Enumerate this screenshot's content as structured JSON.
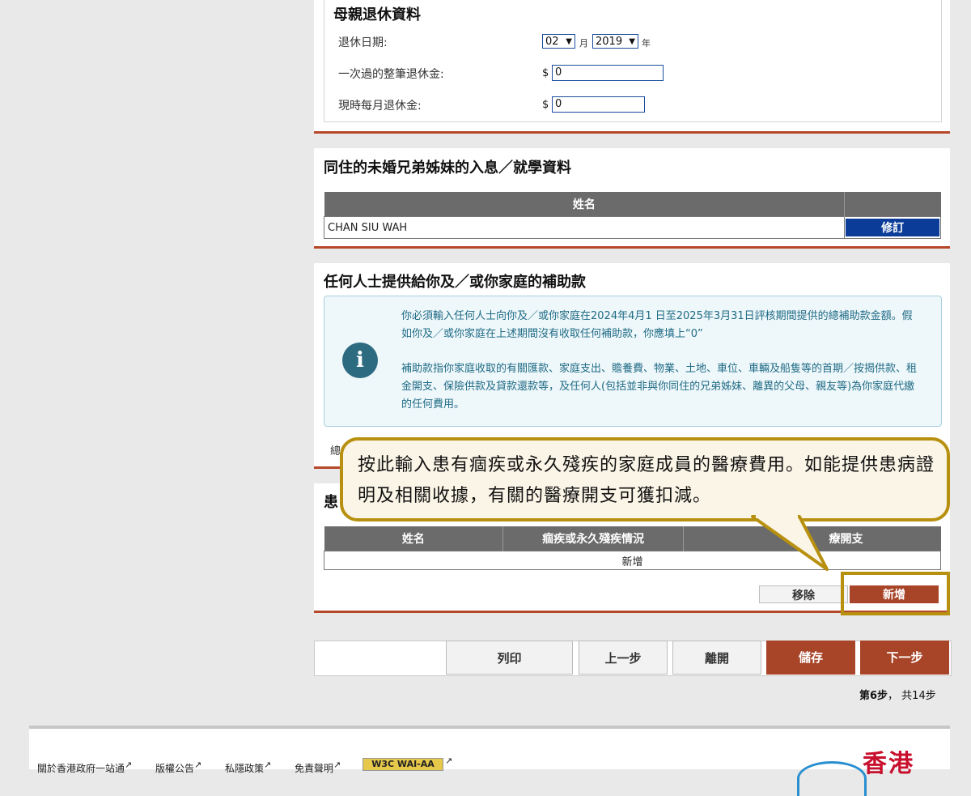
{
  "retirement": {
    "title": "母親退休資料",
    "retire_date_label": "退休日期:",
    "month_value": "02",
    "month_unit": "月",
    "year_value": "2019",
    "year_unit": "年",
    "lump_sum_label": "一次過的整筆退休金:",
    "lump_sum_value": "0",
    "monthly_label": "現時每月退休金:",
    "monthly_value": "0",
    "currency": "$"
  },
  "siblings": {
    "title": "同住的未婚兄弟姊妹的入息／就學資料",
    "col_name": "姓名",
    "rows": [
      {
        "name": "CHAN SIU WAH",
        "action": "修訂"
      }
    ]
  },
  "subsidy": {
    "title": "任何人士提供給你及／或你家庭的補助款",
    "icon_letter": "i",
    "info_p1": "你必須輸入任何人士向你及／或你家庭在2024年4月1 日至2025年3月31日評核期間提供的總補助款金額。假如你及／或你家庭在上述期間沒有收取任何補助款，你應填上“0”",
    "info_p2": "補助款指你家庭收取的有關匯款、家庭支出、贍養費、物業、土地、車位、車輛及船隻等的首期／按揭供款、租金開支、保險供款及貸款還款等，及任何人(包括並非與你同住的兄弟姊妹、離異的父母、親友等)為你家庭代繳的任何費用。",
    "partial_label": "總"
  },
  "medical": {
    "title_partial": "患",
    "col_name": "姓名",
    "col_condition": "痼疾或永久殘疾情況",
    "col_expense": "療開支",
    "empty_row": "新增",
    "remove_label": "移除",
    "add_label": "新增"
  },
  "callout": {
    "text": "按此輸入患有痼疾或永久殘疾的家庭成員的醫療費用。如能提供患病證明及相關收據，有關的醫療開支可獲扣減。"
  },
  "nav": {
    "print": "列印",
    "prev": "上一步",
    "leave": "離開",
    "save": "儲存",
    "next": "下一步",
    "step_current": "第6步",
    "step_total": "， 共14步"
  },
  "footer": {
    "links": [
      "關於香港政府一站通",
      "版權公告",
      "私隱政策",
      "免責聲明"
    ],
    "badge": "W3C WAI-AA",
    "brand": "香港"
  },
  "colors": {
    "accent_red": "#a84428",
    "divider_red": "#b6482a",
    "edit_blue": "#0b3c98",
    "callout_border": "#b8900f",
    "info_blue": "#1f6b85"
  }
}
